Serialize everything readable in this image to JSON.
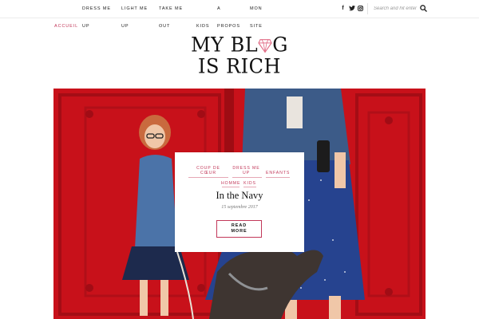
{
  "nav": {
    "items": [
      {
        "top": "",
        "bottom": "Accueil",
        "active": true
      },
      {
        "top": "Dress me",
        "bottom": "up",
        "active": false
      },
      {
        "top": "Light me",
        "bottom": "up",
        "active": false
      },
      {
        "top": "Take me",
        "bottom": "out",
        "active": false
      },
      {
        "top": "",
        "bottom": "Kids",
        "active": false
      },
      {
        "top": "A",
        "bottom": "propos",
        "active": false
      },
      {
        "top": "Mon",
        "bottom": "site",
        "active": false
      }
    ]
  },
  "social": [
    {
      "icon": "facebook-icon",
      "glyph": "f"
    },
    {
      "icon": "twitter-icon",
      "glyph": "t"
    },
    {
      "icon": "instagram-icon",
      "glyph": "o"
    }
  ],
  "search": {
    "placeholder": "Search and hit enter"
  },
  "logo": {
    "line1": "MY BL",
    "line1b": "G",
    "line2": "IS RICH"
  },
  "post": {
    "categories": [
      "Coup de cœur",
      "Dress me up",
      "Enfants"
    ],
    "tags": [
      "Homme",
      "Kids"
    ],
    "title": "In the Navy",
    "date": "15 septembre 2017",
    "cta": "Read more"
  },
  "colors": {
    "accent": "#c2385a",
    "wall": "#c8111a"
  }
}
